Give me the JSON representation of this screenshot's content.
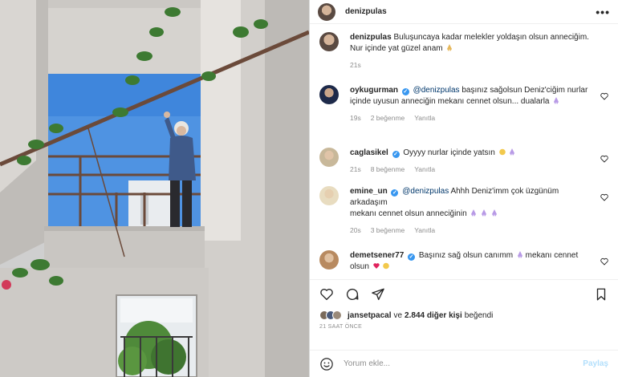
{
  "post": {
    "author": "denizpulas",
    "more_label": "•••"
  },
  "caption": {
    "username": "denizpulas",
    "text": "Buluşuncaya kadar melekler yoldaşın olsun anneciğim. Nur içinde yat güzel anam",
    "time": "21s"
  },
  "comments": [
    {
      "username": "oykugurman",
      "mention": "@denizpulas",
      "text": "başınız sağolsun Deniz'ciğim nurlar içinde uyusun anneciğin mekanı cennet olsun... dualarla",
      "time": "19s",
      "likes": "2 beğenme",
      "reply": "Yanıtla"
    },
    {
      "username": "caglasikel",
      "text": "Oyyyy nurlar içinde yatsın",
      "time": "21s",
      "likes": "8 beğenme",
      "reply": "Yanıtla"
    },
    {
      "username": "emine_un",
      "mention": "@denizpulas",
      "text_line1": "Ahhh Deniz'imm çok üzgünüm arkadaşım",
      "text_line2": "mekanı cennet olsun anneciğinin",
      "time": "20s",
      "likes": "3 beğenme",
      "reply": "Yanıtla"
    },
    {
      "username": "demetsener77",
      "text": "Başınız sağ olsun canımm",
      "text_after": "mekanı cennet",
      "text_line2": "olsun"
    }
  ],
  "likes": {
    "user": "jansetpacal",
    "connector": "ve",
    "others": "2.844 diğer kişi",
    "suffix": "beğendi"
  },
  "date_label": "21 SAAT ÖNCE",
  "comment_box": {
    "placeholder": "Yorum ekle...",
    "post_label": "Paylaş"
  },
  "colors": {
    "link": "#00376b",
    "verified": "#3897f0",
    "muted": "#8e8e8e",
    "sky": "#4a8fe0"
  }
}
